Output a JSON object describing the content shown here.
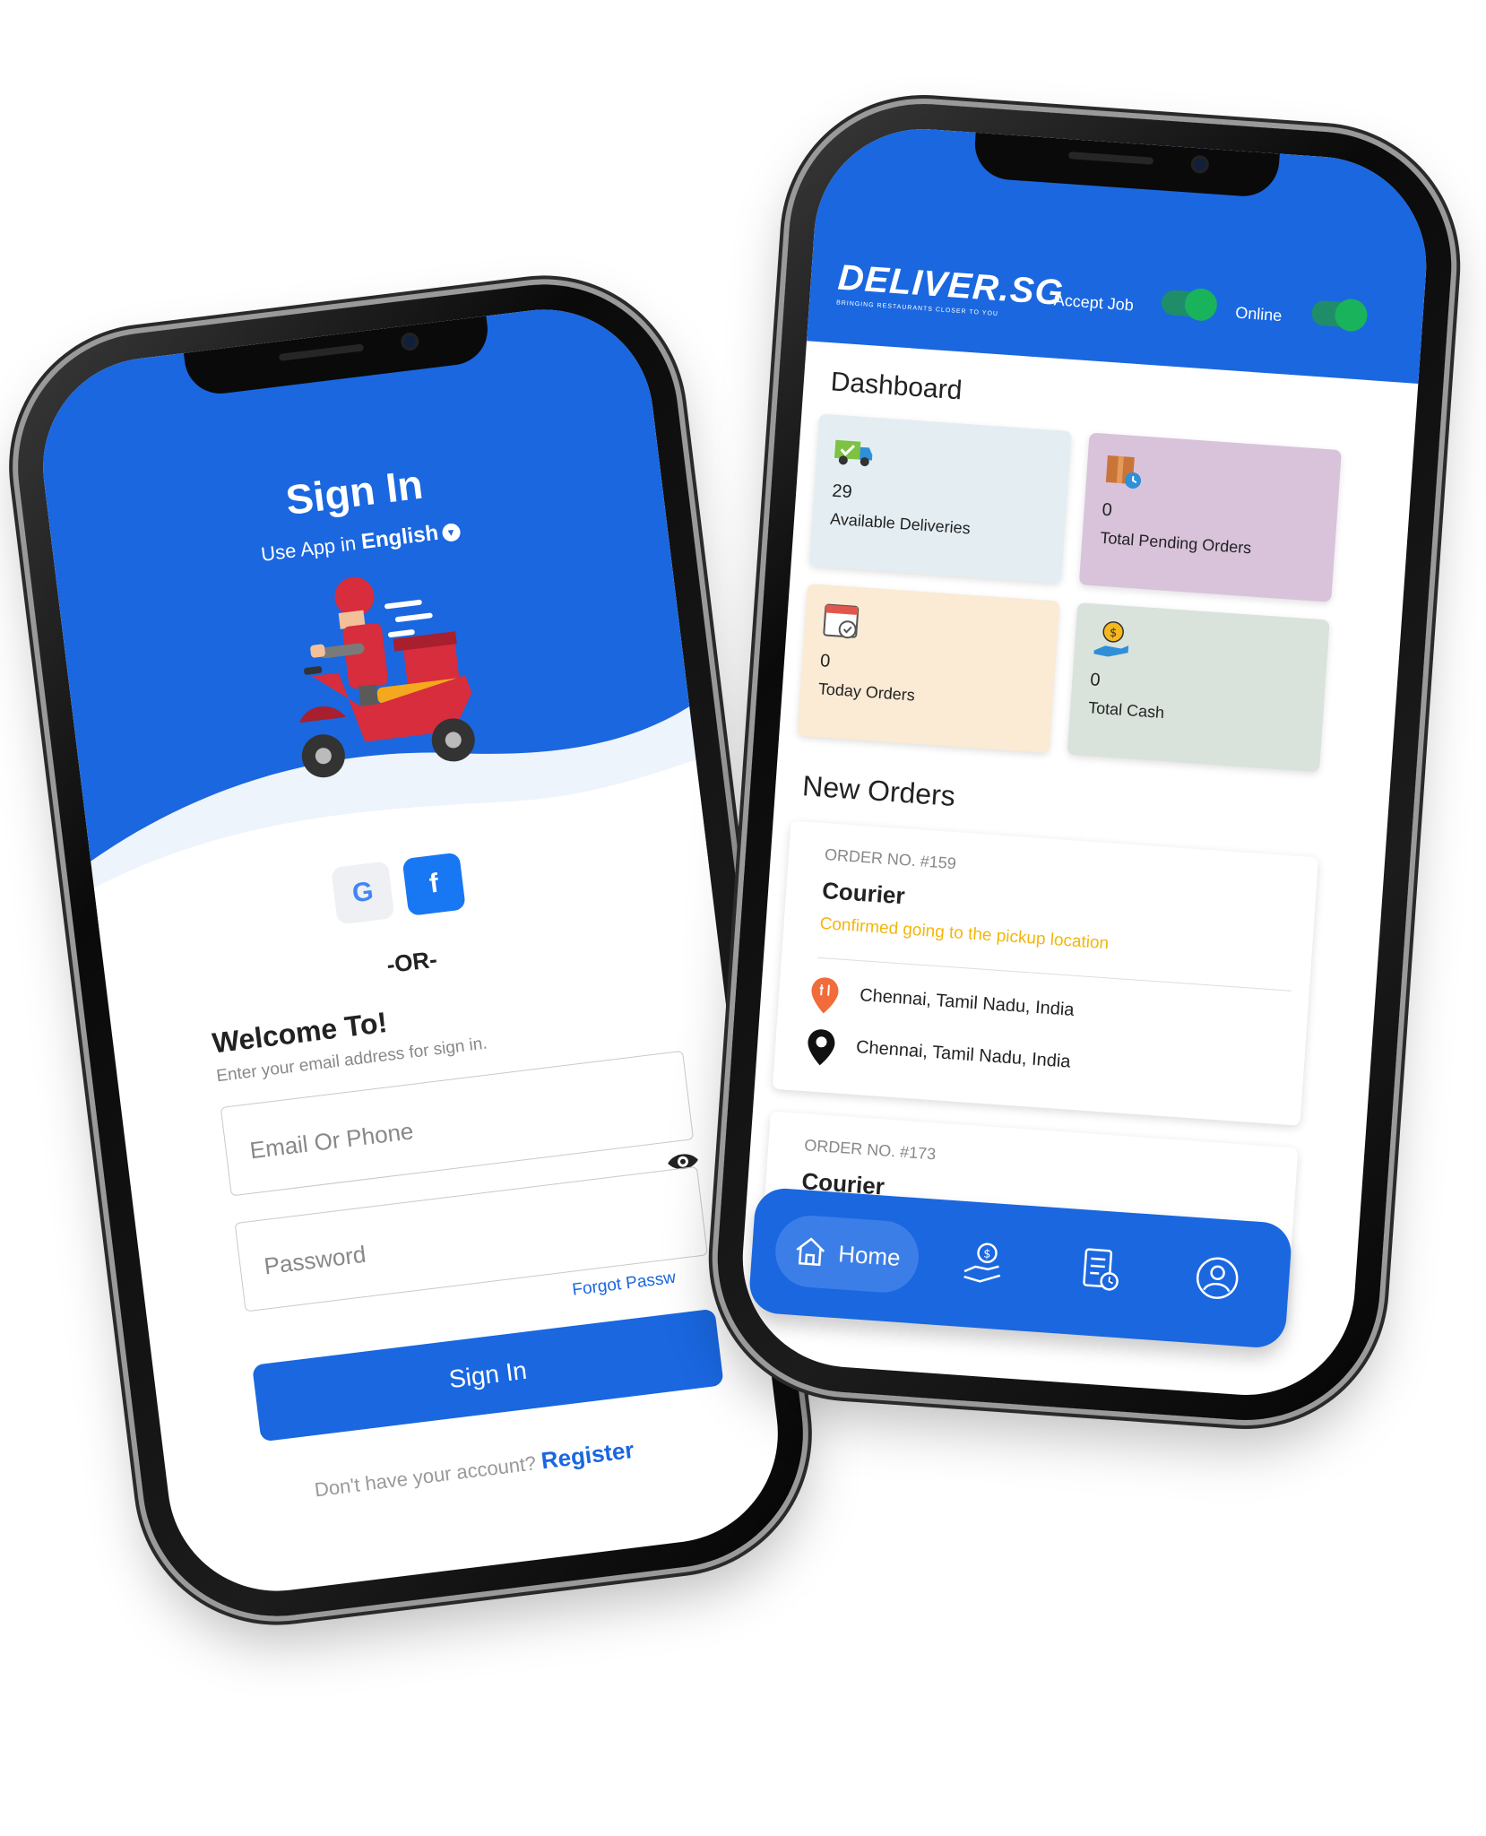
{
  "signin": {
    "title": "Sign In",
    "lang_prefix": "Use App in",
    "lang_value": "English",
    "social": {
      "google": "G",
      "facebook": "f"
    },
    "or": "-OR-",
    "welcome_title": "Welcome To!",
    "welcome_sub": "Enter your email address for sign in.",
    "email_placeholder": "Email Or Phone",
    "password_placeholder": "Password",
    "forgot_label": "Forgot Passw",
    "submit_label": "Sign In",
    "register_prompt": "Don't have your account?",
    "register_link": "Register"
  },
  "dashboard": {
    "logo": "DELIVER.SG",
    "logo_tagline": "BRINGING RESTAURANTS CLOSER TO YOU",
    "toggles": [
      {
        "label": "Accept Job",
        "on": true
      },
      {
        "label": "Online",
        "on": true
      }
    ],
    "title": "Dashboard",
    "cards": [
      {
        "value": "29",
        "label": "Available Deliveries",
        "color": "#e4eef2",
        "icon": "delivery-truck-icon"
      },
      {
        "value": "0",
        "label": "Total Pending Orders",
        "color": "#d8c3db",
        "icon": "package-clock-icon"
      },
      {
        "value": "0",
        "label": "Today Orders",
        "color": "#fbead4",
        "icon": "calendar-check-icon"
      },
      {
        "value": "0",
        "label": "Total Cash",
        "color": "#d9e3dc",
        "icon": "hand-coin-icon"
      }
    ],
    "new_orders_title": "New Orders",
    "orders": [
      {
        "number": "ORDER NO. #159",
        "type": "Courier",
        "status": "Confirmed going to the pickup location",
        "pickup": "Chennai, Tamil Nadu, India",
        "drop": "Chennai, Tamil Nadu, India"
      },
      {
        "number": "ORDER NO. #173",
        "type": "Courier"
      }
    ],
    "nav": {
      "home_label": "Home"
    }
  },
  "colors": {
    "primary": "#1a67e0",
    "status_yellow": "#f2b60a",
    "toggle_green": "#19b35b"
  }
}
